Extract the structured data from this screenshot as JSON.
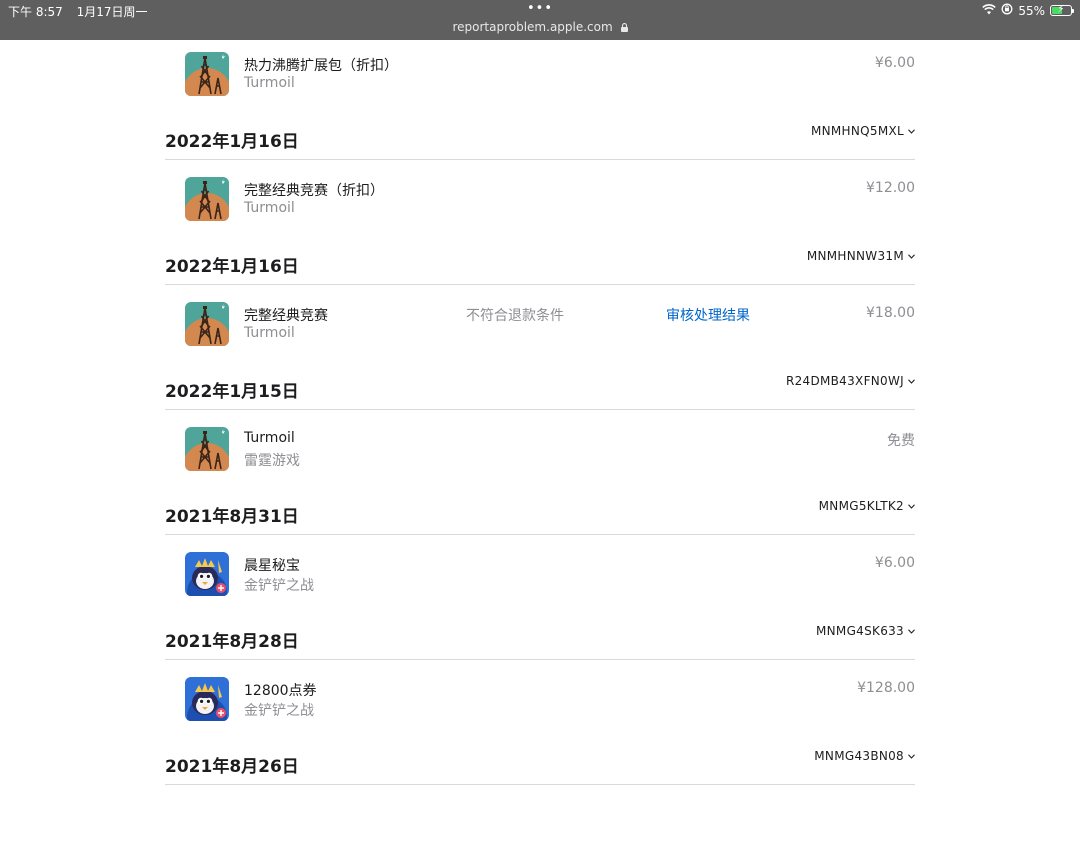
{
  "status_bar": {
    "time": "下午 8:57",
    "date": "1月17日周一",
    "url": "reportaproblem.apple.com",
    "battery": "55%",
    "battery_level": 0.55,
    "dots": "•••"
  },
  "purchases": [
    {
      "date": "2022年1月16日",
      "order_id": "",
      "item": {
        "title": "热力沸腾扩展包（折扣）",
        "subtitle": "Turmoil",
        "price": "¥6.00",
        "icon": "turmoil-app-icon"
      }
    },
    {
      "date": "2022年1月16日",
      "order_id": "MNMHNQ5MXL",
      "item": {
        "title": "完整经典竞赛（折扣）",
        "subtitle": "Turmoil",
        "price": "¥12.00",
        "icon": "turmoil-app-icon"
      }
    },
    {
      "date": "2022年1月16日",
      "order_id": "MNMHNNW31M",
      "item": {
        "title": "完整经典竞赛",
        "subtitle": "Turmoil",
        "status": "不符合退款条件",
        "action": "审核处理结果",
        "price": "¥18.00",
        "icon": "turmoil-app-icon"
      }
    },
    {
      "date": "2022年1月15日",
      "order_id": "R24DMB43XFN0WJ",
      "item": {
        "title": "Turmoil",
        "subtitle": "雷霆游戏",
        "price": "免费",
        "icon": "turmoil-app-icon"
      }
    },
    {
      "date": "2021年8月31日",
      "order_id": "MNMG5KLTK2",
      "item": {
        "title": "晨星秘宝",
        "subtitle": "金铲铲之战",
        "price": "¥6.00",
        "icon": "penguin-app-icon"
      }
    },
    {
      "date": "2021年8月28日",
      "order_id": "MNMG4SK633",
      "item": {
        "title": "12800点券",
        "subtitle": "金铲铲之战",
        "price": "¥128.00",
        "icon": "penguin-app-icon"
      }
    },
    {
      "date": "2021年8月26日",
      "order_id": "MNMG43BN08",
      "item": null
    }
  ]
}
